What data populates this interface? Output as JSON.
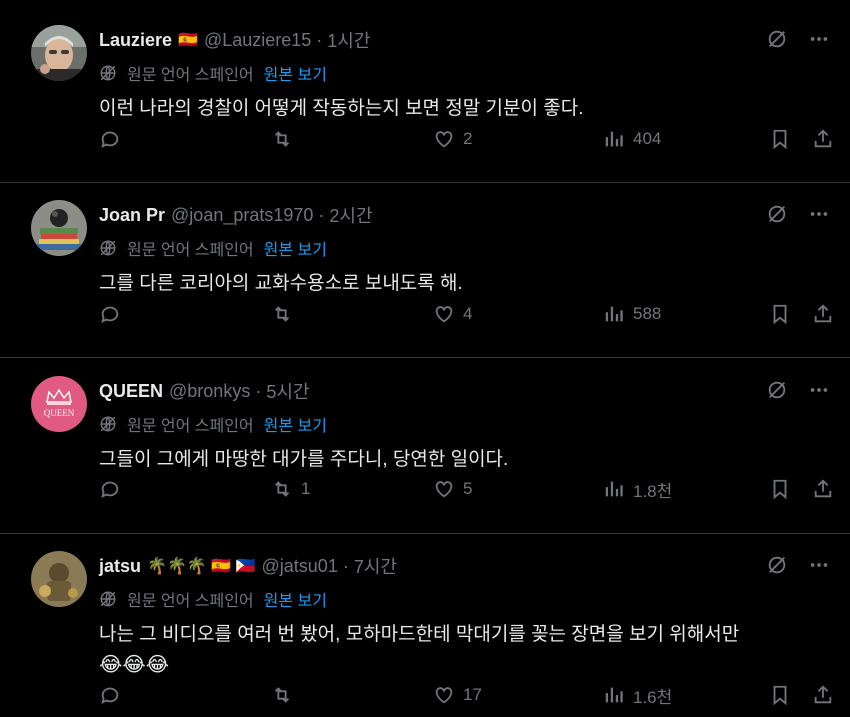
{
  "translate": {
    "label": "원문 언어 스페인어",
    "link": "원본 보기"
  },
  "colors": {
    "background": "#000000",
    "text": "#e7e9ea",
    "muted": "#71767b",
    "link": "#1d9bf0",
    "divider": "#2f3336"
  },
  "tweets": [
    {
      "name": "Lauziere",
      "flags": "🇪🇸",
      "handle": "@Lauziere15",
      "time": "1시간",
      "text": "이런 나라의 경찰이 어떻게 작동하는지 보면 정말 기분이 좋다.",
      "replies": "",
      "retweets": "",
      "likes": "2",
      "views": "404"
    },
    {
      "name": "Joan Pr",
      "flags": "",
      "handle": "@joan_prats1970",
      "time": "2시간",
      "text": "그를 다른 코리아의 교화수용소로 보내도록 해.",
      "replies": "",
      "retweets": "",
      "likes": "4",
      "views": "588"
    },
    {
      "name": "QUEEN",
      "flags": "",
      "handle": "@bronkys",
      "time": "5시간",
      "avatar_text": "QUEEN",
      "text": "그들이 그에게 마땅한 대가를 주다니, 당연한 일이다.",
      "replies": "",
      "retweets": "1",
      "likes": "5",
      "views": "1.8천"
    },
    {
      "name": "jatsu",
      "flags": "🌴🌴🌴 🇪🇸 🇵🇭",
      "handle": "@jatsu01",
      "time": "7시간",
      "text": "나는 그 비디오를 여러 번 봤어, 모하마드한테 막대기를 꽂는 장면을 보기 위해서만",
      "emoji": "😂😂😂",
      "replies": "",
      "retweets": "",
      "likes": "17",
      "views": "1.6천"
    }
  ]
}
